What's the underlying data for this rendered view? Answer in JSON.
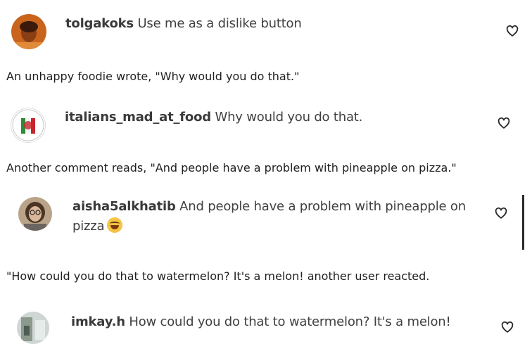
{
  "comments": [
    {
      "username": "tolgakoks",
      "text": "Use me as a dislike button",
      "avatar": "orange-portrait-avatar"
    },
    {
      "username": "italians_mad_at_food",
      "text": "Why would you do that.",
      "avatar": "italian-flag-logo-avatar"
    },
    {
      "username": "aisha5alkhatib",
      "text": "And people have a problem with pineapple on",
      "text2": "pizza",
      "emoji": "laughing-crying-emoji",
      "avatar": "woman-glasses-avatar"
    },
    {
      "username": "imkay.h",
      "text": "How could you do that to watermelon? It's a melon!",
      "avatar": "photo-avatar"
    }
  ],
  "paragraphs": [
    "An unhappy foodie wrote, \"Why would you do that.\"",
    "Another comment reads, \"And people have a problem with pineapple on pizza.\"",
    "\"How could you do that to watermelon? It's a melon! another user reacted."
  ],
  "icons": {
    "like": "heart-outline-icon"
  }
}
